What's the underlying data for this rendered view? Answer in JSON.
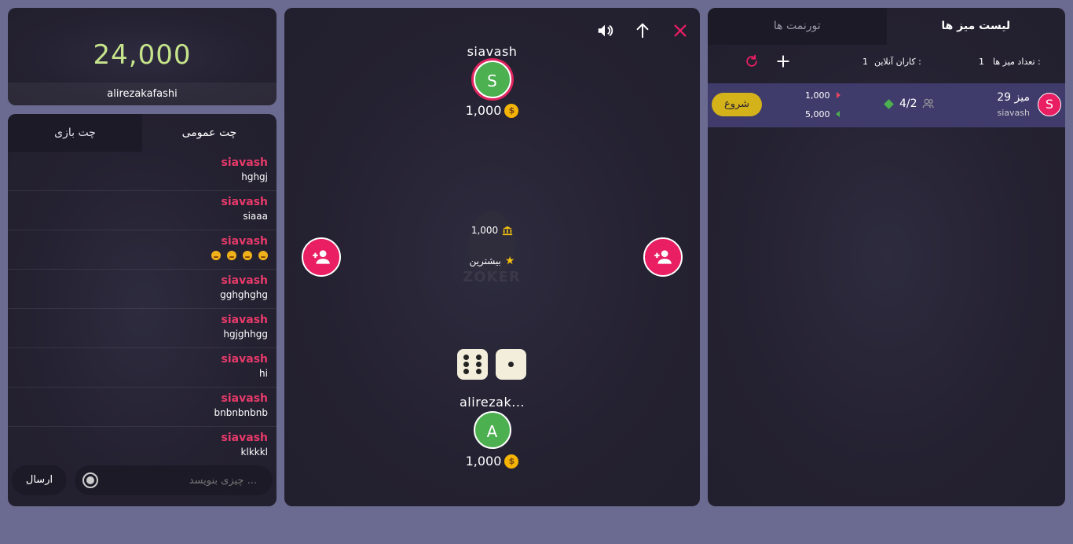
{
  "balance": {
    "amount": "24,000",
    "username": "alirezakafashi"
  },
  "chat": {
    "tab_game": "چت بازی",
    "tab_public": "چت عمومی",
    "messages": [
      {
        "sender": "siavash",
        "text": "hghgj"
      },
      {
        "sender": "siavash",
        "text": "siaaa"
      },
      {
        "sender": "siavash",
        "text": ""
      },
      {
        "sender": "siavash",
        "text": "gghghghg"
      },
      {
        "sender": "siavash",
        "text": "hgjghhgg"
      },
      {
        "sender": "siavash",
        "text": "hi"
      },
      {
        "sender": "siavash",
        "text": "bnbnbnbnb"
      },
      {
        "sender": "siavash",
        "text": "klkkkl"
      }
    ],
    "send_label": "ارسال",
    "input_placeholder": "چیزی بنویسد ..."
  },
  "game": {
    "top_player": {
      "name": "siavash",
      "initial": "S",
      "balance": "1,000"
    },
    "bottom_player": {
      "name": "alirezak...",
      "initial": "A",
      "balance": "1,000"
    },
    "pot": "1,000",
    "max_label": "بیشترین",
    "logo_text": "ZOKER",
    "coin_symbol": "$",
    "dice": [
      6,
      1
    ]
  },
  "tables": {
    "tab_list": "لیست میز ها",
    "tab_tournaments": "تورنمت ها",
    "tables_count_label": "تعداد میز ها :",
    "tables_count": "1",
    "online_users_label": "کاران آنلاین :",
    "online_users": "1",
    "row": {
      "avatar_initial": "S",
      "table_name": "میز 29",
      "owner": "siavash",
      "players": "4/2",
      "min_bet": "1,000",
      "max_bet": "5,000",
      "start_label": "شروع"
    }
  },
  "colors": {
    "page_bg": "#6b6a90",
    "accent_pink": "#e91e63",
    "green": "#4caf50",
    "gold": "#d4b21a",
    "balance_green": "#c6e48b"
  }
}
